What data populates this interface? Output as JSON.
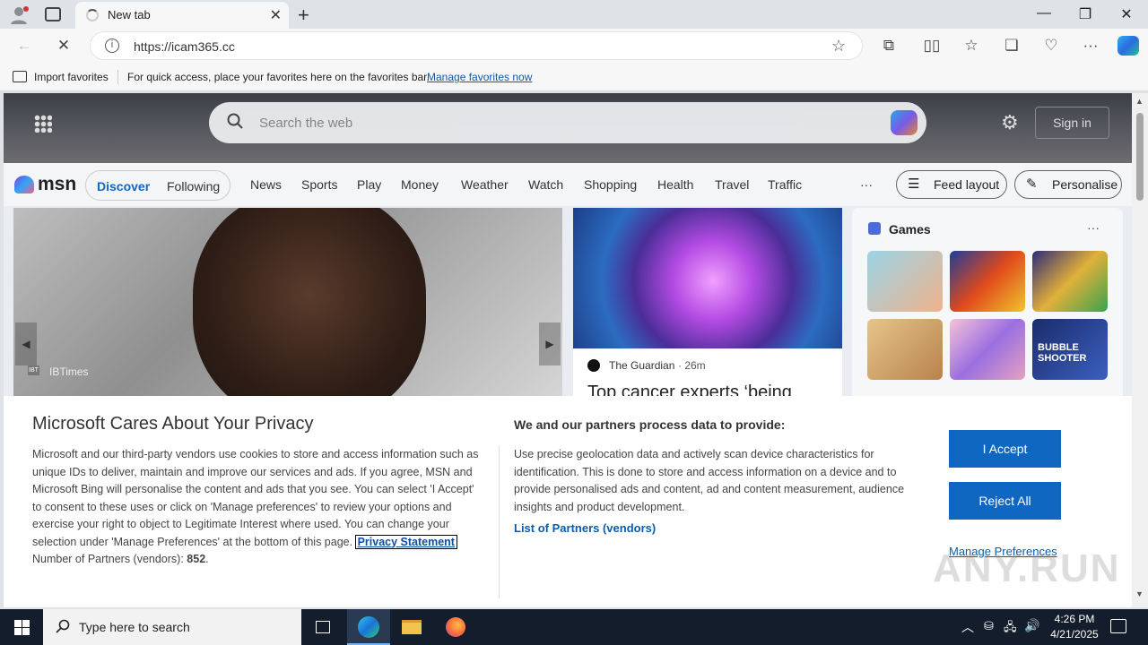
{
  "browser": {
    "tab_title": "New tab",
    "url": "https://icam365.cc"
  },
  "favorites_bar": {
    "import_label": "Import favorites",
    "hint": "For quick access, place your favorites here on the favorites bar.",
    "manage_link": "Manage favorites now"
  },
  "msn": {
    "search_placeholder": "Search the web",
    "sign_in": "Sign in",
    "logo_text": "msn",
    "tabs": [
      "Discover",
      "Following"
    ],
    "nav": [
      "News",
      "Sports",
      "Play",
      "Money",
      "Weather",
      "Watch",
      "Shopping",
      "Health",
      "Travel",
      "Traffic"
    ],
    "more": "···",
    "feed_layout": "Feed layout",
    "personalise": "Personalise",
    "main_card_source": "IBTimes",
    "main_card_source_badge": "IBT",
    "guardian_source": "The Guardian",
    "guardian_time": "· 26m",
    "guardian_headline": "Top cancer experts ‘being",
    "games_title": "Games",
    "games_more": "···",
    "bubble_shooter_label": "BUBBLE SHOOTER"
  },
  "consent": {
    "title": "Microsoft Cares About Your Privacy",
    "body": "Microsoft and our third-party vendors use cookies to store and access information such as unique IDs to deliver, maintain and improve our services and ads. If you agree, MSN and Microsoft Bing will personalise the content and ads that you see. You can select 'I Accept' to consent to these uses or click on 'Manage preferences' to review your options and exercise your right to object to Legitimate Interest where used. You can change your selection under 'Manage Preferences' at the bottom of this page.",
    "privacy_link": "Privacy Statement",
    "partners_count_label": "Number of Partners (vendors):",
    "partners_count": "852",
    "right_title": "We and our partners process data to provide:",
    "right_body": "Use precise geolocation data and actively scan device characteristics for identification. This is done to store and access information on a device and to provide personalised ads and content, ad and content measurement, audience insights and product development.",
    "partners_link": "List of Partners (vendors)",
    "accept": "I Accept",
    "reject": "Reject All",
    "manage": "Manage Preferences"
  },
  "taskbar": {
    "search_placeholder": "Type here to search",
    "time": "4:26 PM",
    "date": "4/21/2025"
  },
  "watermark": "ANY.RUN",
  "colors": {
    "accent": "#0f67c2",
    "link": "#0b5cad",
    "taskbar": "#141d2b"
  }
}
